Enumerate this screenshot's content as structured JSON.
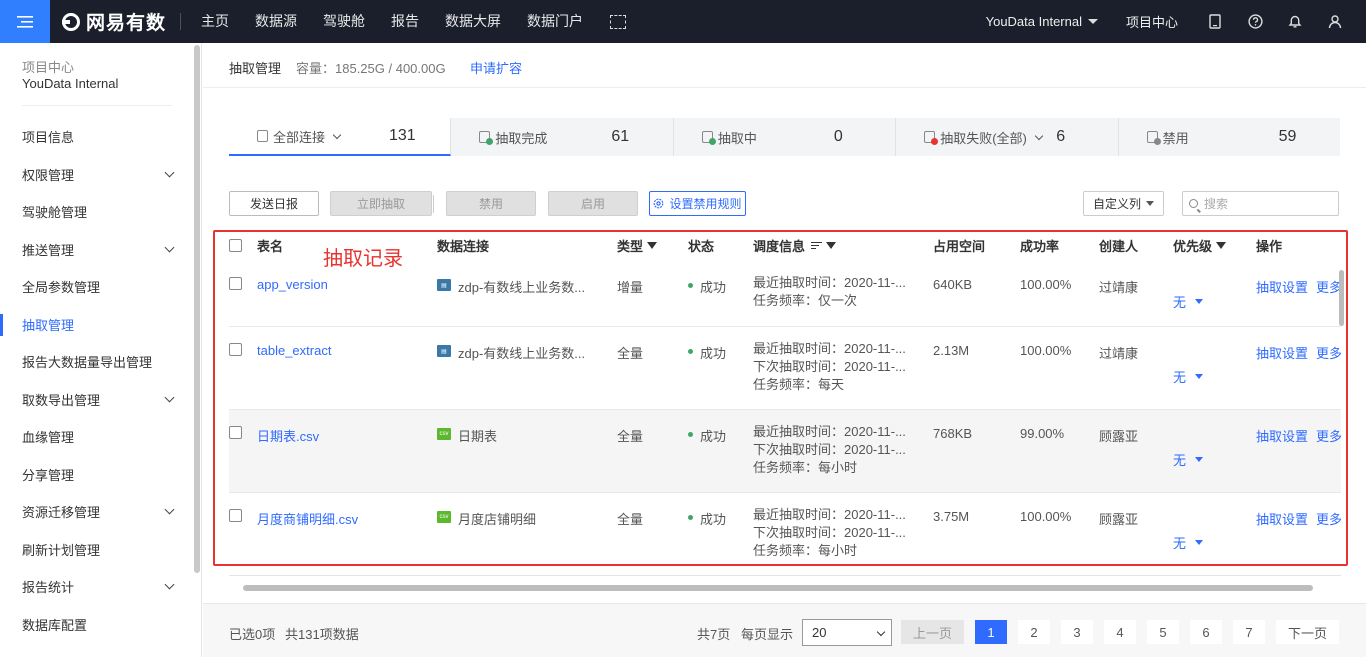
{
  "topbar": {
    "brand": "网易有数",
    "nav": [
      "主页",
      "数据源",
      "驾驶舱",
      "报告",
      "数据大屏",
      "数据门户"
    ],
    "workspace": "YouData Internal",
    "project_center": "项目中心",
    "icons": [
      "menu-icon",
      "layout-icon",
      "tablet-icon",
      "help-icon",
      "bell-icon",
      "user-icon"
    ]
  },
  "sidebar": {
    "project_label": "项目中心",
    "project_name": "YouData Internal",
    "items": [
      {
        "label": "项目信息",
        "expandable": false
      },
      {
        "label": "权限管理",
        "expandable": true
      },
      {
        "label": "驾驶舱管理",
        "expandable": false
      },
      {
        "label": "推送管理",
        "expandable": true
      },
      {
        "label": "全局参数管理",
        "expandable": false
      },
      {
        "label": "抽取管理",
        "expandable": false,
        "active": true
      },
      {
        "label": "报告大数据量导出管理",
        "expandable": false
      },
      {
        "label": "取数导出管理",
        "expandable": true
      },
      {
        "label": "血缘管理",
        "expandable": false
      },
      {
        "label": "分享管理",
        "expandable": false
      },
      {
        "label": "资源迁移管理",
        "expandable": true
      },
      {
        "label": "刷新计划管理",
        "expandable": false
      },
      {
        "label": "报告统计",
        "expandable": true
      },
      {
        "label": "数据库配置",
        "expandable": false
      }
    ]
  },
  "header": {
    "title": "抽取管理",
    "capacity": "容量：185.25G / 400.00G",
    "apply": "申请扩容"
  },
  "stats": [
    {
      "label": "全部连接",
      "count": "131",
      "active": true,
      "dropdown": true,
      "icon": "db-icon"
    },
    {
      "label": "抽取完成",
      "count": "61",
      "icon": "db-success-icon",
      "color": "#3fa66a"
    },
    {
      "label": "抽取中",
      "count": "0",
      "icon": "db-running-icon",
      "color": "#3fa66a"
    },
    {
      "label": "抽取失败(全部)",
      "count": "6",
      "dropdown": true,
      "icon": "db-failed-icon",
      "color": "#e8332f"
    },
    {
      "label": "禁用",
      "count": "59",
      "icon": "db-disabled-icon",
      "color": "#888888"
    }
  ],
  "toolbar": {
    "send_daily": "发送日报",
    "extract_now": "立即抽取",
    "disable": "禁用",
    "enable": "启用",
    "disable_rule": "设置禁用规则",
    "custom_columns": "自定义列",
    "search_placeholder": "搜索"
  },
  "annotation": "抽取记录",
  "table": {
    "headers": {
      "name": "表名",
      "source": "数据连接",
      "type": "类型",
      "status": "状态",
      "schedule": "调度信息",
      "space": "占用空间",
      "rate": "成功率",
      "creator": "创建人",
      "priority": "优先级",
      "ops": "操作"
    },
    "rows": [
      {
        "name": "app_version",
        "source": "zdp-有数线上业务数...",
        "source_kind": "db",
        "type": "增量",
        "status": "成功",
        "schedule": [
          "最近抽取时间：2020-11-...",
          "任务频率：仅一次"
        ],
        "space": "640KB",
        "rate": "100.00%",
        "creator": "过靖康",
        "priority": "无",
        "op1": "抽取设置",
        "op2": "更多"
      },
      {
        "name": "table_extract",
        "source": "zdp-有数线上业务数...",
        "source_kind": "db",
        "type": "全量",
        "status": "成功",
        "schedule": [
          "最近抽取时间：2020-11-...",
          "下次抽取时间：2020-11-...",
          "任务频率：每天"
        ],
        "space": "2.13M",
        "rate": "100.00%",
        "creator": "过靖康",
        "priority": "无",
        "op1": "抽取设置",
        "op2": "更多"
      },
      {
        "name": "日期表.csv",
        "source": "日期表",
        "source_kind": "csv",
        "type": "全量",
        "status": "成功",
        "schedule": [
          "最近抽取时间：2020-11-...",
          "下次抽取时间：2020-11-...",
          "任务频率：每小时"
        ],
        "space": "768KB",
        "rate": "99.00%",
        "creator": "顾露亚",
        "priority": "无",
        "op1": "抽取设置",
        "op2": "更多",
        "highlight": true
      },
      {
        "name": "月度商铺明细.csv",
        "source": "月度店铺明细",
        "source_kind": "csv",
        "type": "全量",
        "status": "成功",
        "schedule": [
          "最近抽取时间：2020-11-...",
          "下次抽取时间：2020-11-...",
          "任务频率：每小时"
        ],
        "space": "3.75M",
        "rate": "100.00%",
        "creator": "顾露亚",
        "priority": "无",
        "op1": "抽取设置",
        "op2": "更多"
      }
    ]
  },
  "footer": {
    "selected": "已选0项",
    "total": "共131项数据",
    "pages": "共7页",
    "per_page_label": "每页显示",
    "page_size": "20",
    "prev": "上一页",
    "next": "下一页",
    "page_numbers": [
      "1",
      "2",
      "3",
      "4",
      "5",
      "6",
      "7"
    ],
    "current_page": "1"
  },
  "colors": {
    "accent": "#2f6bff",
    "topbar": "#1a1f2b",
    "success": "#3fa66a",
    "annotation": "#e8332f"
  }
}
